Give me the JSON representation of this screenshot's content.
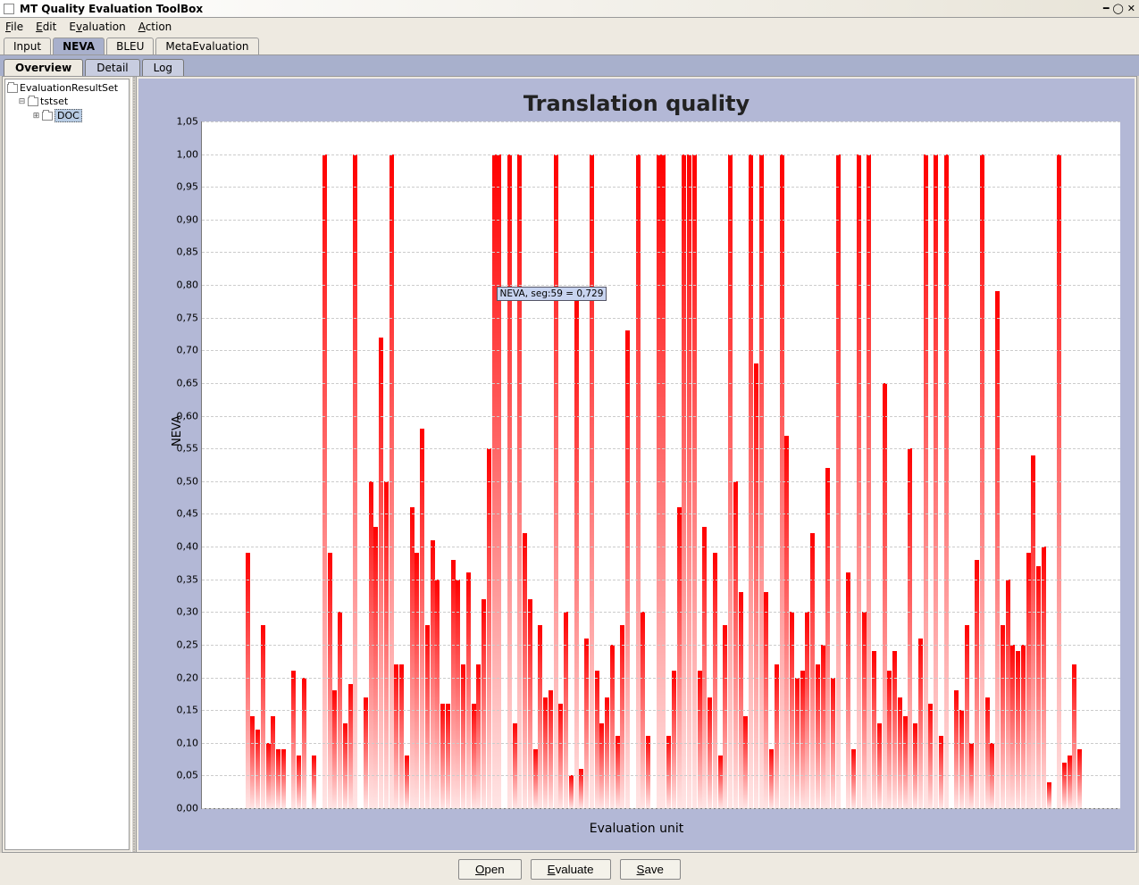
{
  "window": {
    "title": "MT Quality Evaluation ToolBox"
  },
  "menubar": {
    "items": [
      "File",
      "Edit",
      "Evaluation",
      "Action"
    ]
  },
  "tabs": {
    "items": [
      "Input",
      "NEVA",
      "BLEU",
      "MetaEvaluation"
    ],
    "active": 1
  },
  "subtabs": {
    "items": [
      "Overview",
      "Detail",
      "Log"
    ],
    "active": 0
  },
  "tree": {
    "root": "EvaluationResultSet",
    "child": "tstset",
    "leaf": "DOC"
  },
  "chart": {
    "title": "Translation quality",
    "ylabel": "NEVA",
    "xlabel": "Evaluation unit",
    "tooltip": "NEVA, seg:59 = 0,729"
  },
  "buttons": {
    "open": "Open",
    "evaluate": "Evaluate",
    "save": "Save"
  },
  "chart_data": {
    "type": "bar",
    "title": "Translation quality",
    "xlabel": "Evaluation unit",
    "ylabel": "NEVA",
    "ylim": [
      0.0,
      1.05
    ],
    "yticks": [
      "0,00",
      "0,05",
      "0,10",
      "0,15",
      "0,20",
      "0,25",
      "0,30",
      "0,35",
      "0,40",
      "0,45",
      "0,50",
      "0,55",
      "0,60",
      "0,65",
      "0,70",
      "0,75",
      "0,80",
      "0,85",
      "0,90",
      "0,95",
      "1,00",
      "1,05"
    ],
    "tooltip": {
      "x": 59,
      "y": 0.729,
      "text": "NEVA, seg:59 = 0,729"
    },
    "values": [
      0,
      0,
      0,
      0,
      0,
      0,
      0,
      0.39,
      0.14,
      0.12,
      0.28,
      0.1,
      0.14,
      0.09,
      0.09,
      0,
      0.21,
      0.08,
      0.2,
      0,
      0.08,
      0,
      1.0,
      0.39,
      0.18,
      0.3,
      0.13,
      0.19,
      1.0,
      0,
      0.17,
      0.5,
      0.43,
      0.72,
      0.5,
      1.0,
      0.22,
      0.22,
      0.08,
      0.46,
      0.39,
      0.58,
      0.28,
      0.41,
      0.35,
      0.16,
      0.16,
      0.38,
      0.35,
      0.22,
      0.36,
      0.16,
      0.22,
      0.32,
      0.55,
      1.0,
      1.0,
      0,
      1.0,
      0.13,
      1.0,
      0.42,
      0.32,
      0.09,
      0.28,
      0.17,
      0.18,
      1.0,
      0.16,
      0.3,
      0.05,
      0.79,
      0.06,
      0.26,
      1.0,
      0.21,
      0.13,
      0.17,
      0.25,
      0.11,
      0.28,
      0.73,
      0,
      1.0,
      0.3,
      0.11,
      0,
      1.0,
      1.0,
      0.11,
      0.21,
      0.46,
      1.0,
      1.0,
      1.0,
      0.21,
      0.43,
      0.17,
      0.39,
      0.08,
      0.28,
      1.0,
      0.5,
      0.33,
      0.14,
      1.0,
      0.68,
      1.0,
      0.33,
      0.09,
      0.22,
      1.0,
      0.57,
      0.3,
      0.2,
      0.21,
      0.3,
      0.42,
      0.22,
      0.25,
      0.52,
      0.2,
      1.0,
      0,
      0.36,
      0.09,
      1.0,
      0.3,
      1.0,
      0.24,
      0.13,
      0.65,
      0.21,
      0.24,
      0.17,
      0.14,
      0.55,
      0.13,
      0.26,
      1.0,
      0.16,
      1.0,
      0.11,
      1.0,
      0,
      0.18,
      0.15,
      0.28,
      0.1,
      0.38,
      1.0,
      0.17,
      0.1,
      0.79,
      0.28,
      0.35,
      0.25,
      0.24,
      0.25,
      0.39,
      0.54,
      0.37,
      0.4,
      0.04,
      0,
      1.0,
      0.07,
      0.08,
      0.22,
      0.09,
      0,
      0,
      0,
      0,
      0,
      0
    ]
  }
}
